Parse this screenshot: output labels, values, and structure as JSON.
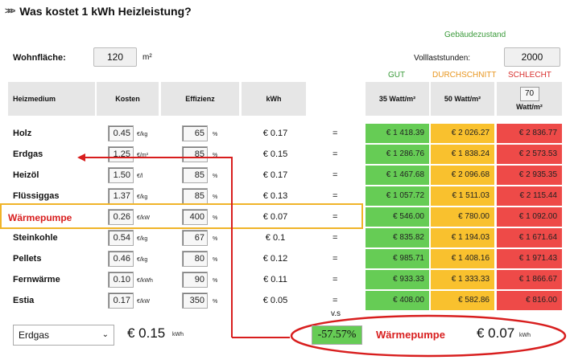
{
  "title": "Was kostet 1 kWh Heizleistung?",
  "gebaeudezustand_label": "Gebäudezustand",
  "wohnflaeche": {
    "label": "Wohnfläche:",
    "value": "120",
    "unit": "m²"
  },
  "volllast": {
    "label": "Volllaststunden:",
    "value": "2000"
  },
  "status_labels": {
    "gut": "GUT",
    "durchschnitt": "DURCHSCHNITT",
    "schlecht": "SCHLECHT"
  },
  "headers": {
    "heizmedium": "Heizmedium",
    "kosten": "Kosten",
    "effizienz": "Effizienz",
    "kwh": "kWh",
    "w35": "35 Watt/m²",
    "w50": "50 Watt/m²",
    "custom_value": "70",
    "custom_unit": "Watt/m²"
  },
  "rows": [
    {
      "name": "Holz",
      "cost": "0.45",
      "cost_unit": "€/kg",
      "eff": "65",
      "eff_unit": "%",
      "kwh": "€ 0.17",
      "eq": "=",
      "gut": "€ 1 418.39",
      "dur": "€ 2 026.27",
      "sch": "€ 2 836.77"
    },
    {
      "name": "Erdgas",
      "cost": "1.25",
      "cost_unit": "€/m³",
      "eff": "85",
      "eff_unit": "%",
      "kwh": "€ 0.15",
      "eq": "=",
      "gut": "€ 1 286.76",
      "dur": "€ 1 838.24",
      "sch": "€ 2 573.53"
    },
    {
      "name": "Heizöl",
      "cost": "1.50",
      "cost_unit": "€/l",
      "eff": "85",
      "eff_unit": "%",
      "kwh": "€ 0.17",
      "eq": "=",
      "gut": "€ 1 467.68",
      "dur": "€ 2 096.68",
      "sch": "€ 2 935.35"
    },
    {
      "name": "Flüssiggas",
      "cost": "1.37",
      "cost_unit": "€/kg",
      "eff": "85",
      "eff_unit": "%",
      "kwh": "€ 0.13",
      "eq": "=",
      "gut": "€ 1 057.72",
      "dur": "€ 1 511.03",
      "sch": "€ 2 115.44"
    },
    {
      "name": "Wärmepumpe",
      "cost": "0.26",
      "cost_unit": "€/kW",
      "eff": "400",
      "eff_unit": "%",
      "kwh": "€ 0.07",
      "eq": "=",
      "gut": "€ 546.00",
      "dur": "€ 780.00",
      "sch": "€ 1 092.00"
    },
    {
      "name": "Steinkohle",
      "cost": "0.54",
      "cost_unit": "€/kg",
      "eff": "67",
      "eff_unit": "%",
      "kwh": "€ 0.1",
      "eq": "=",
      "gut": "€ 835.82",
      "dur": "€ 1 194.03",
      "sch": "€ 1 671.64"
    },
    {
      "name": "Pellets",
      "cost": "0.46",
      "cost_unit": "€/kg",
      "eff": "80",
      "eff_unit": "%",
      "kwh": "€ 0.12",
      "eq": "=",
      "gut": "€ 985.71",
      "dur": "€ 1 408.16",
      "sch": "€ 1 971.43"
    },
    {
      "name": "Fernwärme",
      "cost": "0.10",
      "cost_unit": "€/kWh",
      "eff": "90",
      "eff_unit": "%",
      "kwh": "€ 0.11",
      "eq": "=",
      "gut": "€ 933.33",
      "dur": "€ 1 333.33",
      "sch": "€ 1 866.67"
    },
    {
      "name": "Estia",
      "cost": "0.17",
      "cost_unit": "€/kW",
      "eff": "350",
      "eff_unit": "%",
      "kwh": "€ 0.05",
      "eq": "=",
      "gut": "€ 408.00",
      "dur": "€ 582.86",
      "sch": "€ 816.00"
    }
  ],
  "bottom": {
    "select_value": "Erdgas",
    "left_price": "€ 0.15",
    "left_unit": "kWh",
    "vs_label": "v.s",
    "percent": "-57.57%",
    "compare_name": "Wärmepumpe",
    "right_price": "€ 0.07",
    "right_unit": "kWh"
  },
  "colors": {
    "gut": "#66cc55",
    "durchschnitt": "#f9c12e",
    "schlecht": "#ee4a48",
    "highlight": "#f0b429",
    "annotation": "#d81e1e"
  }
}
